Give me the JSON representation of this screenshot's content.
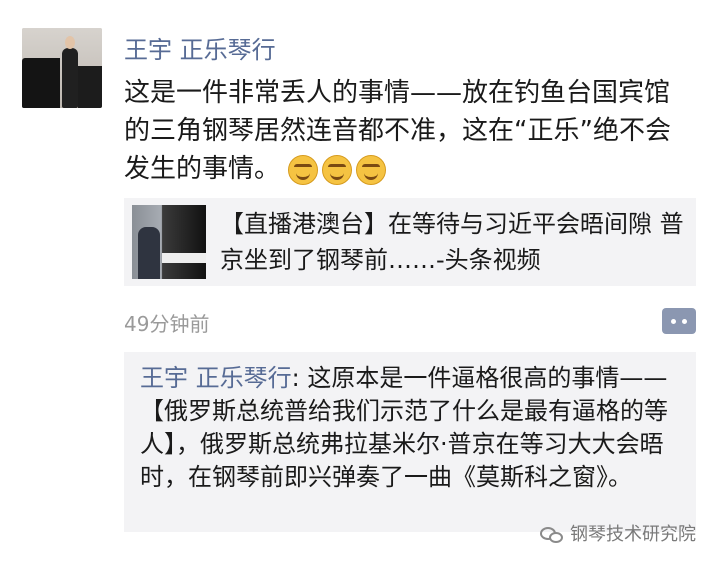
{
  "post": {
    "author": "王宇 正乐琴行",
    "text": "这是一件非常丢人的事情——放在钓鱼台国宾馆的三角钢琴居然连音都不准，这在“正乐”绝不会发生的事情。",
    "emojis": [
      "face-with-tears-of-joy-icon",
      "face-with-tears-of-joy-icon",
      "face-with-tears-of-joy-icon"
    ]
  },
  "link": {
    "title": "【直播港澳台】在等待与习近平会晤间隙 普京坐到了钢琴前……-头条视频"
  },
  "meta": {
    "time": "49分钟前"
  },
  "comments": {
    "author": "王宇 正乐琴行",
    "separator": ": ",
    "text": "这原本是一件逼格很高的事情——【俄罗斯总统普给我们示范了什么是最有逼格的等人】，俄罗斯总统弗拉基米尔·普京在等习大大会晤时，在钢琴前即兴弹奏了一曲《莫斯科之窗》。"
  },
  "watermark": {
    "text": "钢琴技术研究院",
    "icon": "wechat-icon"
  },
  "colors": {
    "name_link": "#576b95",
    "card_bg": "#f3f3f5",
    "time_gray": "#9a9a9a"
  }
}
